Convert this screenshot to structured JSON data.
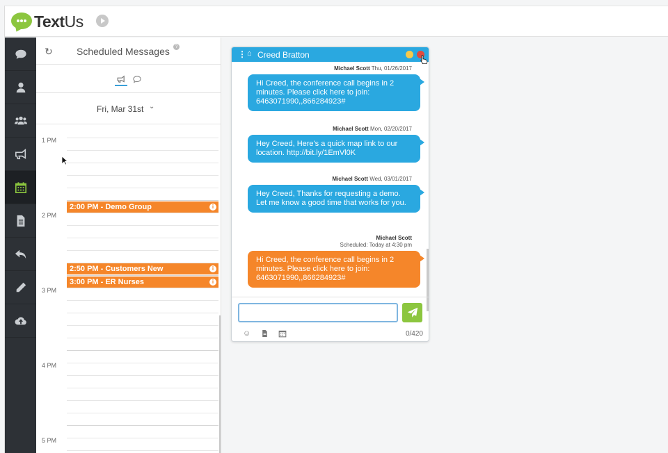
{
  "app": {
    "brand_text": "Text",
    "brand_suffix": "Us"
  },
  "sidebar": {
    "items": [
      {
        "name": "conversations",
        "icon": "chat-icon"
      },
      {
        "name": "contacts",
        "icon": "user-icon"
      },
      {
        "name": "groups",
        "icon": "users-icon"
      },
      {
        "name": "broadcasts",
        "icon": "megaphone-icon"
      },
      {
        "name": "scheduled",
        "icon": "calendar-icon",
        "active": true
      },
      {
        "name": "templates",
        "icon": "document-icon"
      },
      {
        "name": "auto-replies",
        "icon": "reply-icon"
      },
      {
        "name": "notes",
        "icon": "pencil-icon"
      },
      {
        "name": "upload",
        "icon": "cloud-upload-icon"
      }
    ]
  },
  "scheduled": {
    "title": "Scheduled Messages",
    "date": "Fri, Mar 31st",
    "hours": [
      "1 PM",
      "2 PM",
      "3 PM",
      "4 PM",
      "5 PM"
    ],
    "events": [
      {
        "label": "2:00 PM - Demo Group"
      },
      {
        "label": "2:50 PM - Customers New"
      },
      {
        "label": "3:00 PM - ER Nurses"
      }
    ]
  },
  "chat": {
    "contact": "Creed Bratton",
    "messages": [
      {
        "sender": "Michael Scott",
        "time": "Thu, 01/26/2017",
        "text": "Hi Creed, the conference call begins in 2 minutes. Please click here to join: 6463071990,,866284923#"
      },
      {
        "sender": "Michael Scott",
        "time": "Mon, 02/20/2017",
        "text": "Hey Creed, Here's a quick map link to our location. http://bit.ly/1EmVl0K"
      },
      {
        "sender": "Michael Scott",
        "time": "Wed, 03/01/2017",
        "text": "Hey Creed, Thanks for requesting a demo. Let me know a good time that works for you."
      },
      {
        "sender": "Michael Scott",
        "time": "Scheduled: Today at 4:30 pm",
        "text": "Hi Creed, the conference call begins in 2 minutes. Please click here to join: 6463071990,,866284923#",
        "scheduled": true
      }
    ],
    "input_value": "",
    "char_count": "0/420"
  },
  "colors": {
    "accent_green": "#8cc63f",
    "chat_blue": "#2aa8e0",
    "scheduled_orange": "#f5862a",
    "sidebar_bg": "#2d3136"
  }
}
